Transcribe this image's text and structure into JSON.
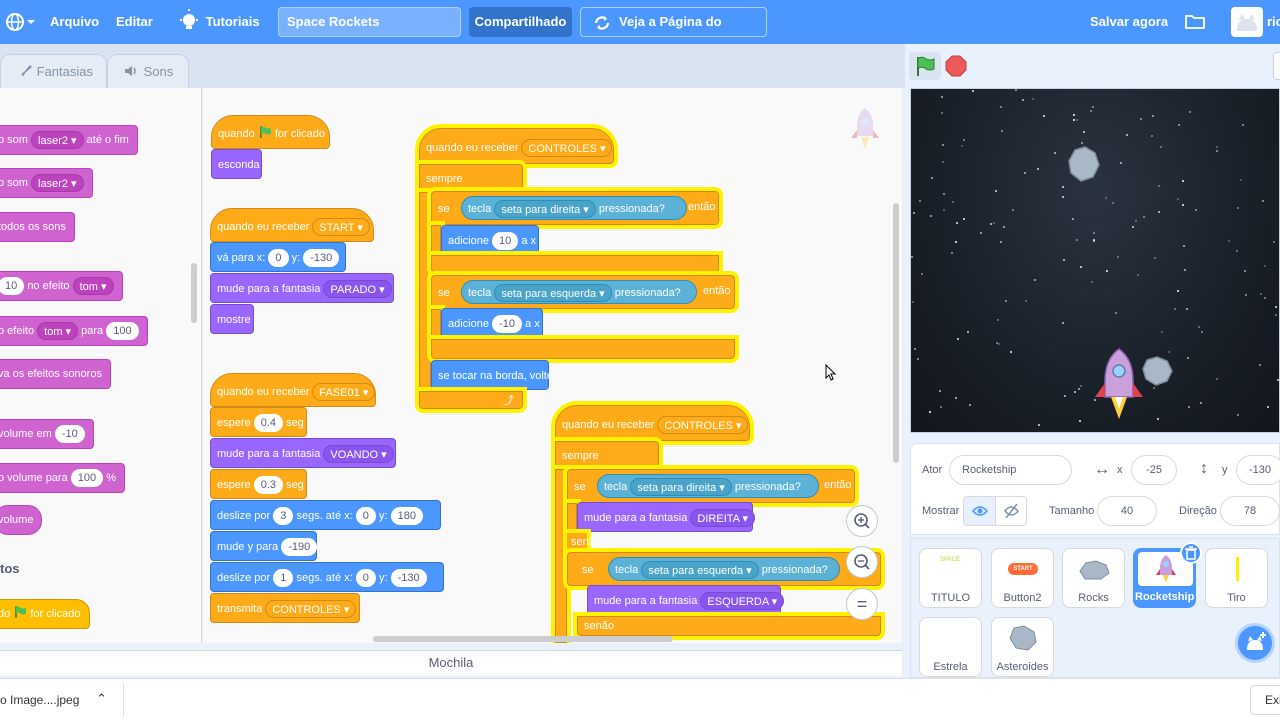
{
  "menu": {
    "file": "Arquivo",
    "edit": "Editar",
    "tutorials": "Tutoriais",
    "project_title": "Space Rockets",
    "share": "Compartilhado",
    "see_project": "Veja a Página do Projeto",
    "save_now": "Salvar agora",
    "user": "ric"
  },
  "tabs": {
    "costumes": "Fantasias",
    "sounds": "Sons"
  },
  "palette": {
    "blocks": [
      {
        "pre": "o som",
        "dd": "laser2",
        "post": "até o fim"
      },
      {
        "pre": "o som",
        "dd": "laser2",
        "post": ""
      },
      {
        "pre": "todos os sons"
      },
      {
        "val": "10",
        "mid": "no efeito",
        "dd": "tom"
      },
      {
        "pre": "o efeito",
        "dd": "tom",
        "mid": "para",
        "val": "100"
      },
      {
        "pre": "va os efeitos sonoros"
      },
      {
        "pre": "volume em",
        "val": "-10"
      },
      {
        "pre": "o volume para",
        "val": "100",
        "post": "%"
      },
      {
        "pre": "volume"
      }
    ],
    "category_heading": "tos",
    "flag_block": {
      "pre": "do",
      "post": "for clicado"
    }
  },
  "scripts": {
    "s1": {
      "hat_pre": "quando",
      "hat_post": "for clicado",
      "b1": "esconda"
    },
    "s2": {
      "hat": "quando eu receber",
      "hat_dd": "START",
      "goto": "vá para x:",
      "x": "0",
      "ylbl": "y:",
      "y": "-130",
      "costume": "mude para a fantasia",
      "costume_dd": "PARADO",
      "show": "mostre"
    },
    "s3": {
      "hat": "quando eu receber",
      "hat_dd": "FASE01",
      "wait1": "espere",
      "wait1_val": "0.4",
      "secs": "seg",
      "costume": "mude para a fantasia",
      "costume_dd": "VOANDO",
      "wait2": "espere",
      "wait2_val": "0.3",
      "glide1": "deslize por",
      "glide1_secs": "3",
      "glide1_mid": "segs. até x:",
      "glide1_x": "0",
      "glide1_ylbl": "y:",
      "glide1_y": "180",
      "changey": "mude y para",
      "changey_val": "-190",
      "glide2": "deslize por",
      "glide2_secs": "1",
      "glide2_mid": "segs. até x:",
      "glide2_x": "0",
      "glide2_ylbl": "y:",
      "glide2_y": "-130",
      "broadcast": "transmita",
      "broadcast_dd": "CONTROLES"
    },
    "s4": {
      "hat": "quando eu receber",
      "hat_dd": "CONTROLES",
      "forever": "sempre",
      "if": "se",
      "then": "então",
      "key": "tecla",
      "key_right": "seta para direita",
      "pressed": "pressionada?",
      "add": "adicione",
      "add_val1": "10",
      "ax": "a x",
      "key_left": "seta para esquerda",
      "add_val2": "-10",
      "bounce": "se tocar na borda, volte"
    },
    "s5": {
      "hat": "quando eu receber",
      "hat_dd": "CONTROLES",
      "forever": "sempre",
      "if": "se",
      "then": "então",
      "key": "tecla",
      "key_right": "seta para direita",
      "pressed": "pressionada?",
      "costume": "mude para a fantasia",
      "costume_dd1": "DIREITA",
      "else": "senão",
      "key_left": "seta para esquerda",
      "costume_dd2": "ESQUERDA",
      "else2": "senão"
    }
  },
  "backpack": "Mochila",
  "sprite_info": {
    "actor_label": "Ator",
    "actor_name": "Rocketship",
    "x_label": "x",
    "x_val": "-25",
    "y_label": "y",
    "y_val": "-130",
    "show_label": "Mostrar",
    "size_label": "Tamanho",
    "size_val": "40",
    "dir_label": "Direção",
    "dir_val": "78"
  },
  "sprites": [
    {
      "name": "TITULO",
      "selected": false
    },
    {
      "name": "Button2",
      "selected": false
    },
    {
      "name": "Rocks",
      "selected": false
    },
    {
      "name": "Rocketship",
      "selected": true
    },
    {
      "name": "Tiro",
      "selected": false
    },
    {
      "name": "Estrela",
      "selected": false
    },
    {
      "name": "Asteroides",
      "selected": false
    }
  ],
  "sprite_thumb_text": {
    "button2": "START",
    "titulo": "SPACE"
  },
  "download": {
    "file": "o Image....jpeg",
    "right": "Exi"
  },
  "colors": {
    "menu": "#4c97ff",
    "events": "#ffab19",
    "looks": "#9966ff",
    "motion": "#4c97ff",
    "sensing": "#5cb1d6",
    "sound": "#cf63cf",
    "highlight": "#fff200"
  }
}
